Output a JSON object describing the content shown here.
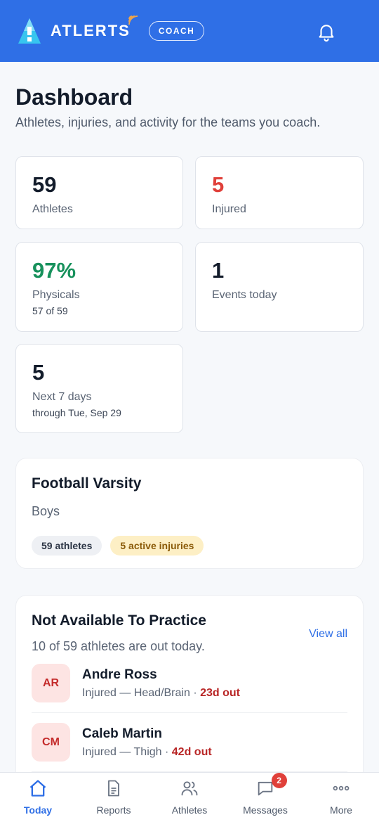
{
  "header": {
    "brand": "ATLERTS",
    "role_badge": "COACH"
  },
  "dashboard": {
    "title": "Dashboard",
    "subtitle": "Athletes, injuries, and activity for the teams you coach."
  },
  "stats": {
    "athletes": {
      "value": "59",
      "label": "Athletes"
    },
    "injured": {
      "value": "5",
      "label": "Injured"
    },
    "physicals": {
      "value": "97%",
      "label": "Physicals",
      "sub": "57 of 59"
    },
    "events_today": {
      "value": "1",
      "label": "Events today"
    },
    "next_7_days": {
      "value": "5",
      "label": "Next 7 days",
      "sub": "through Tue, Sep 29"
    }
  },
  "team": {
    "name": "Football Varsity",
    "gender": "Boys",
    "athletes_pill": "59 athletes",
    "injuries_pill": "5 active injuries"
  },
  "not_available": {
    "title": "Not Available To Practice",
    "view_all": "View all",
    "subtitle": "10 of 59 athletes are out today.",
    "athletes": [
      {
        "initials": "AR",
        "name": "Andre Ross",
        "status": "Injured — Head/Brain",
        "out": "23d out"
      },
      {
        "initials": "CM",
        "name": "Caleb Martin",
        "status": "Injured — Thigh",
        "out": "42d out"
      }
    ]
  },
  "tabbar": {
    "tabs": [
      {
        "label": "Today",
        "icon": "home-icon"
      },
      {
        "label": "Reports",
        "icon": "document-icon"
      },
      {
        "label": "Athletes",
        "icon": "users-icon"
      },
      {
        "label": "Messages",
        "icon": "chat-icon",
        "badge": "2"
      },
      {
        "label": "More",
        "icon": "more-icon"
      }
    ]
  },
  "colors": {
    "brand_blue": "#2f6fe6",
    "injured_red": "#e0403a",
    "physicals_green": "#17915c"
  }
}
